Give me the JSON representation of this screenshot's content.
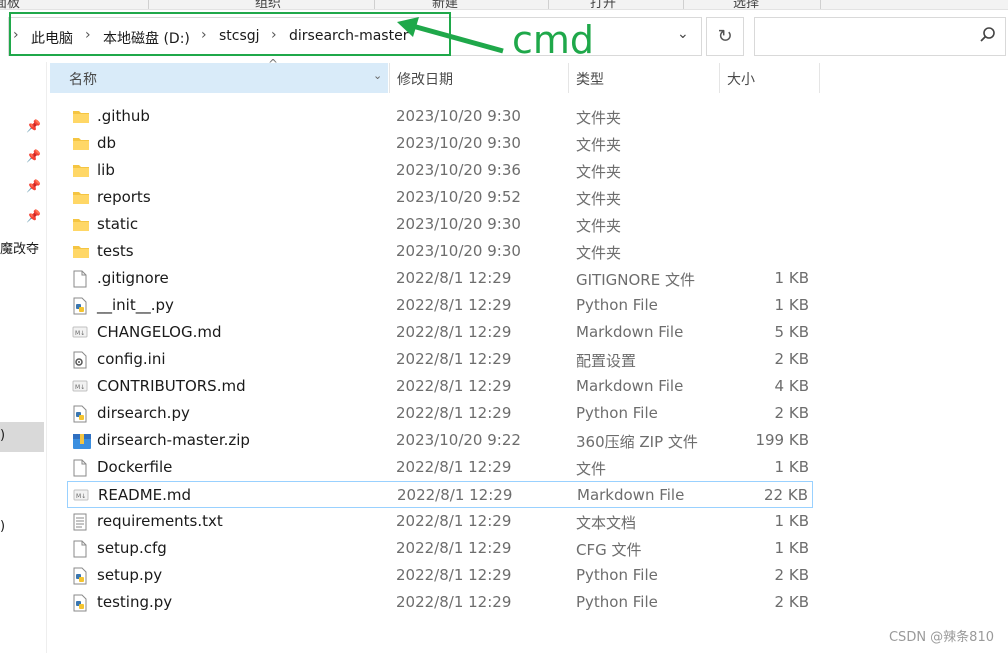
{
  "ribbon": {
    "tabs": [
      "面板",
      "组织",
      "新建",
      "打开",
      "选择"
    ]
  },
  "addressbar": {
    "breadcrumbs": [
      "此电脑",
      "本地磁盘 (D:)",
      "stcsgj",
      "dirsearch-master"
    ]
  },
  "annotation": {
    "label": "cmd",
    "color": "#1fa84a"
  },
  "nav": {
    "fragments": [
      "魔改夺",
      ")",
      ")"
    ]
  },
  "columns": {
    "name": "名称",
    "date": "修改日期",
    "type": "类型",
    "size": "大小"
  },
  "files": [
    {
      "name": ".github",
      "date": "2023/10/20 9:30",
      "type": "文件夹",
      "size": "",
      "icon": "folder-icon"
    },
    {
      "name": "db",
      "date": "2023/10/20 9:30",
      "type": "文件夹",
      "size": "",
      "icon": "folder-icon"
    },
    {
      "name": "lib",
      "date": "2023/10/20 9:36",
      "type": "文件夹",
      "size": "",
      "icon": "folder-icon"
    },
    {
      "name": "reports",
      "date": "2023/10/20 9:52",
      "type": "文件夹",
      "size": "",
      "icon": "folder-icon"
    },
    {
      "name": "static",
      "date": "2023/10/20 9:30",
      "type": "文件夹",
      "size": "",
      "icon": "folder-icon"
    },
    {
      "name": "tests",
      "date": "2023/10/20 9:30",
      "type": "文件夹",
      "size": "",
      "icon": "folder-icon"
    },
    {
      "name": ".gitignore",
      "date": "2022/8/1 12:29",
      "type": "GITIGNORE 文件",
      "size": "1 KB",
      "icon": "file-icon"
    },
    {
      "name": "__init__.py",
      "date": "2022/8/1 12:29",
      "type": "Python File",
      "size": "1 KB",
      "icon": "python-file-icon"
    },
    {
      "name": "CHANGELOG.md",
      "date": "2022/8/1 12:29",
      "type": "Markdown File",
      "size": "5 KB",
      "icon": "markdown-file-icon"
    },
    {
      "name": "config.ini",
      "date": "2022/8/1 12:29",
      "type": "配置设置",
      "size": "2 KB",
      "icon": "config-file-icon"
    },
    {
      "name": "CONTRIBUTORS.md",
      "date": "2022/8/1 12:29",
      "type": "Markdown File",
      "size": "4 KB",
      "icon": "markdown-file-icon"
    },
    {
      "name": "dirsearch.py",
      "date": "2022/8/1 12:29",
      "type": "Python File",
      "size": "2 KB",
      "icon": "python-file-icon"
    },
    {
      "name": "dirsearch-master.zip",
      "date": "2023/10/20 9:22",
      "type": "360压缩 ZIP 文件",
      "size": "199 KB",
      "icon": "zip-archive-icon"
    },
    {
      "name": "Dockerfile",
      "date": "2022/8/1 12:29",
      "type": "文件",
      "size": "1 KB",
      "icon": "file-icon"
    },
    {
      "name": "README.md",
      "date": "2022/8/1 12:29",
      "type": "Markdown File",
      "size": "22 KB",
      "icon": "markdown-file-icon",
      "selected": true
    },
    {
      "name": "requirements.txt",
      "date": "2022/8/1 12:29",
      "type": "文本文档",
      "size": "1 KB",
      "icon": "text-file-icon"
    },
    {
      "name": "setup.cfg",
      "date": "2022/8/1 12:29",
      "type": "CFG 文件",
      "size": "1 KB",
      "icon": "file-icon"
    },
    {
      "name": "setup.py",
      "date": "2022/8/1 12:29",
      "type": "Python File",
      "size": "2 KB",
      "icon": "python-file-icon"
    },
    {
      "name": "testing.py",
      "date": "2022/8/1 12:29",
      "type": "Python File",
      "size": "2 KB",
      "icon": "python-file-icon"
    }
  ],
  "watermark": "CSDN @辣条810"
}
